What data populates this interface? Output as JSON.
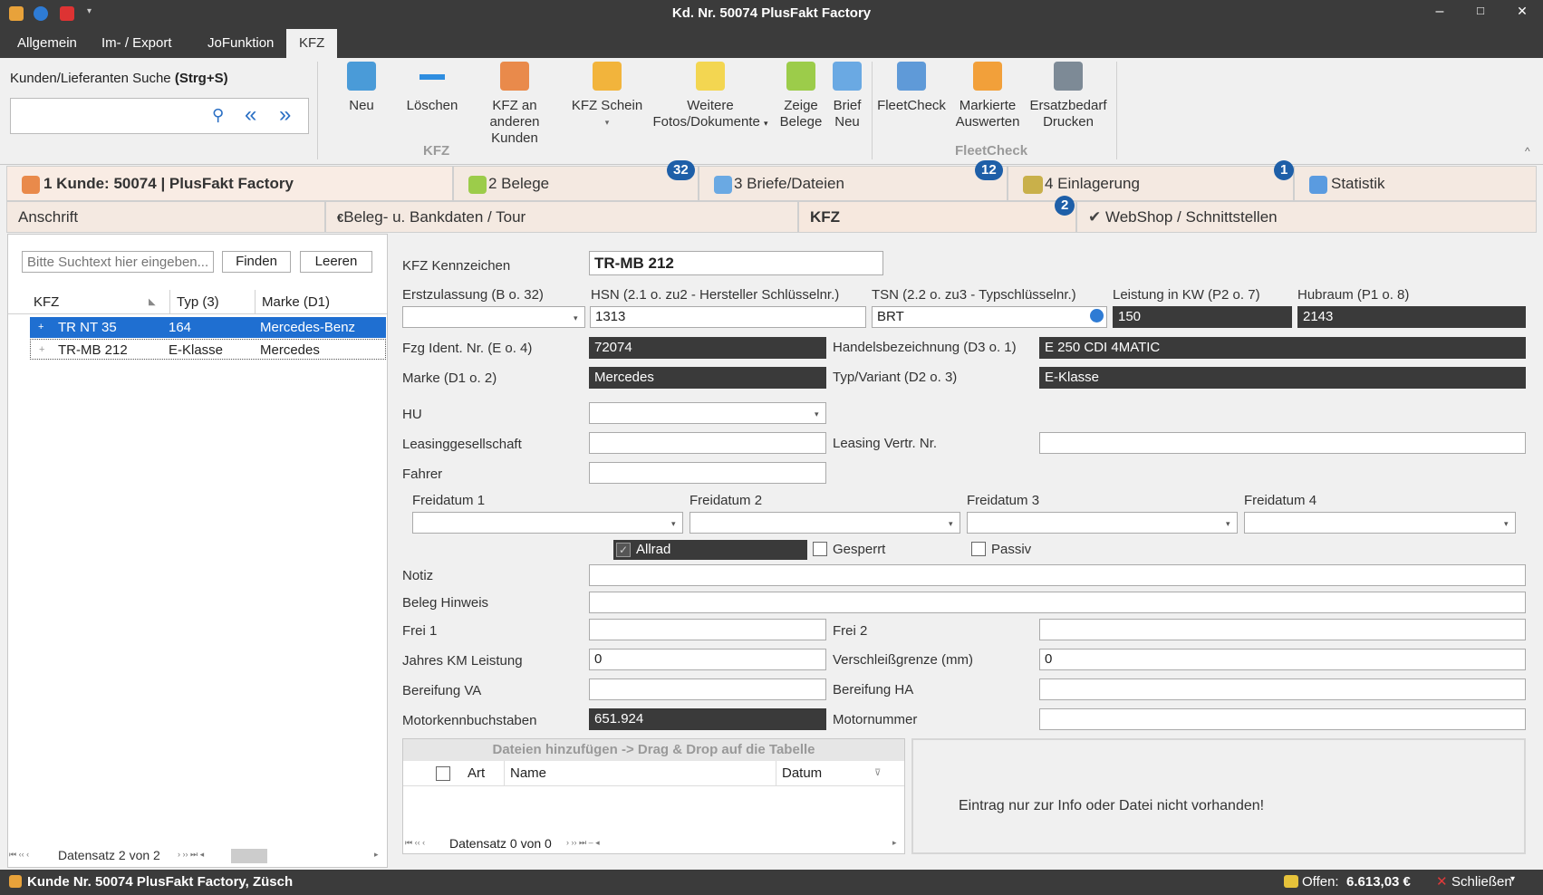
{
  "window": {
    "title": "Kd. Nr. 50074 PlusFakt Factory",
    "minimize": "–",
    "maximize": "□",
    "close": "✕"
  },
  "menu_tabs": [
    "Allgemein",
    "Im- / Export",
    "JoFunktion",
    "KFZ"
  ],
  "search": {
    "label": "Kunden/Lieferanten Suche",
    "shortcut": "(Strg+S)",
    "value": "",
    "prev": "«",
    "next": "»",
    "find_icon": "magnifier-icon"
  },
  "ribbon": {
    "buttons": [
      "Neu",
      "Löschen",
      "KFZ an anderen Kunden",
      "KFZ Schein",
      "Weitere Fotos/Dokumente",
      "Zeige Belege",
      "Brief Neu",
      "FleetCheck",
      "Markierte Auswerten",
      "Ersatzbedarf Drucken"
    ],
    "groups": [
      "KFZ",
      "FleetCheck"
    ],
    "collapse": "^"
  },
  "main_tabs": [
    {
      "label": "1 Kunde: 50074 | PlusFakt Factory",
      "badge": ""
    },
    {
      "label": "2 Belege",
      "badge": "32"
    },
    {
      "label": "3 Briefe/Dateien",
      "badge": "12"
    },
    {
      "label": "4 Einlagerung",
      "badge": "1"
    },
    {
      "label": "Statistik",
      "badge": ""
    }
  ],
  "sub_tabs": [
    {
      "label": "Anschrift",
      "badge": ""
    },
    {
      "label": "Beleg- u. Bankdaten / Tour",
      "badge": ""
    },
    {
      "label": "KFZ",
      "badge": ""
    },
    {
      "label": "WebShop / Schnittstellen",
      "badge": "2"
    }
  ],
  "left": {
    "search_placeholder": "Bitte Suchtext hier eingeben...",
    "find": "Finden",
    "clear": "Leeren",
    "columns": [
      "KFZ",
      "Typ (3)",
      "Marke (D1)"
    ],
    "rows": [
      {
        "kfz": "TR NT 35",
        "typ": "164",
        "marke": "Mercedes-Benz",
        "selected": true
      },
      {
        "kfz": "TR-MB 212",
        "typ": "E-Klasse",
        "marke": "Mercedes",
        "selected": false
      }
    ],
    "nav": "Datensatz 2 von 2"
  },
  "form": {
    "kennzeichen_label": "KFZ Kennzeichen",
    "kennzeichen": "TR-MB 212",
    "ez_label": "Erstzulassung (B o. 32)",
    "ez": "",
    "hsn_label": "HSN (2.1 o. zu2 - Hersteller Schlüsselnr.)",
    "hsn": "1313",
    "tsn_label": "TSN (2.2 o. zu3 - Typschlüsselnr.)",
    "tsn": "BRT",
    "kw_label": "Leistung in KW (P2 o. 7)",
    "kw": "150",
    "hub_label": "Hubraum (P1 o. 8)",
    "hub": "2143",
    "fin_label": "Fzg Ident. Nr. (E o. 4)",
    "fin": "72074",
    "hb_label": "Handelsbezeichnung (D3 o. 1)",
    "hb": "E 250 CDI 4MATIC",
    "marke_label": "Marke (D1 o. 2)",
    "marke": "Mercedes",
    "typ_label": "Typ/Variant (D2 o. 3)",
    "typ": "E-Klasse",
    "hu_label": "HU",
    "hu": "",
    "leasing_label": "Leasinggesellschaft",
    "leasing": "",
    "leasingnr_label": "Leasing Vertr. Nr.",
    "leasingnr": "",
    "fahrer_label": "Fahrer",
    "fahrer": "",
    "freidatum": [
      "Freidatum 1",
      "Freidatum 2",
      "Freidatum 3",
      "Freidatum 4"
    ],
    "allrad": "Allrad",
    "gesperrt": "Gesperrt",
    "passiv": "Passiv",
    "notiz_label": "Notiz",
    "notiz": "",
    "beleg_label": "Beleg Hinweis",
    "beleg": "",
    "frei1_label": "Frei 1",
    "frei1": "",
    "frei2_label": "Frei 2",
    "frei2": "",
    "km_label": "Jahres KM Leistung",
    "km": "0",
    "vg_label": "Verschleißgrenze (mm)",
    "vg": "0",
    "bva_label": "Bereifung VA",
    "bva": "",
    "bha_label": "Bereifung HA",
    "bha": "",
    "mkb_label": "Motorkennbuchstaben",
    "mkb": "651.924",
    "mnr_label": "Motornummer",
    "mnr": ""
  },
  "files": {
    "header": "Dateien hinzufügen -> Drag & Drop auf die Tabelle",
    "columns": [
      "Art",
      "Name",
      "Datum"
    ],
    "nav": "Datensatz 0 von 0",
    "info": "Eintrag nur zur Info oder Datei nicht vorhanden!"
  },
  "status": {
    "left": "Kunde Nr. 50074 PlusFakt Factory, Züsch",
    "offen_label": "Offen:",
    "offen": "6.613,03 €",
    "close": "Schließen"
  }
}
